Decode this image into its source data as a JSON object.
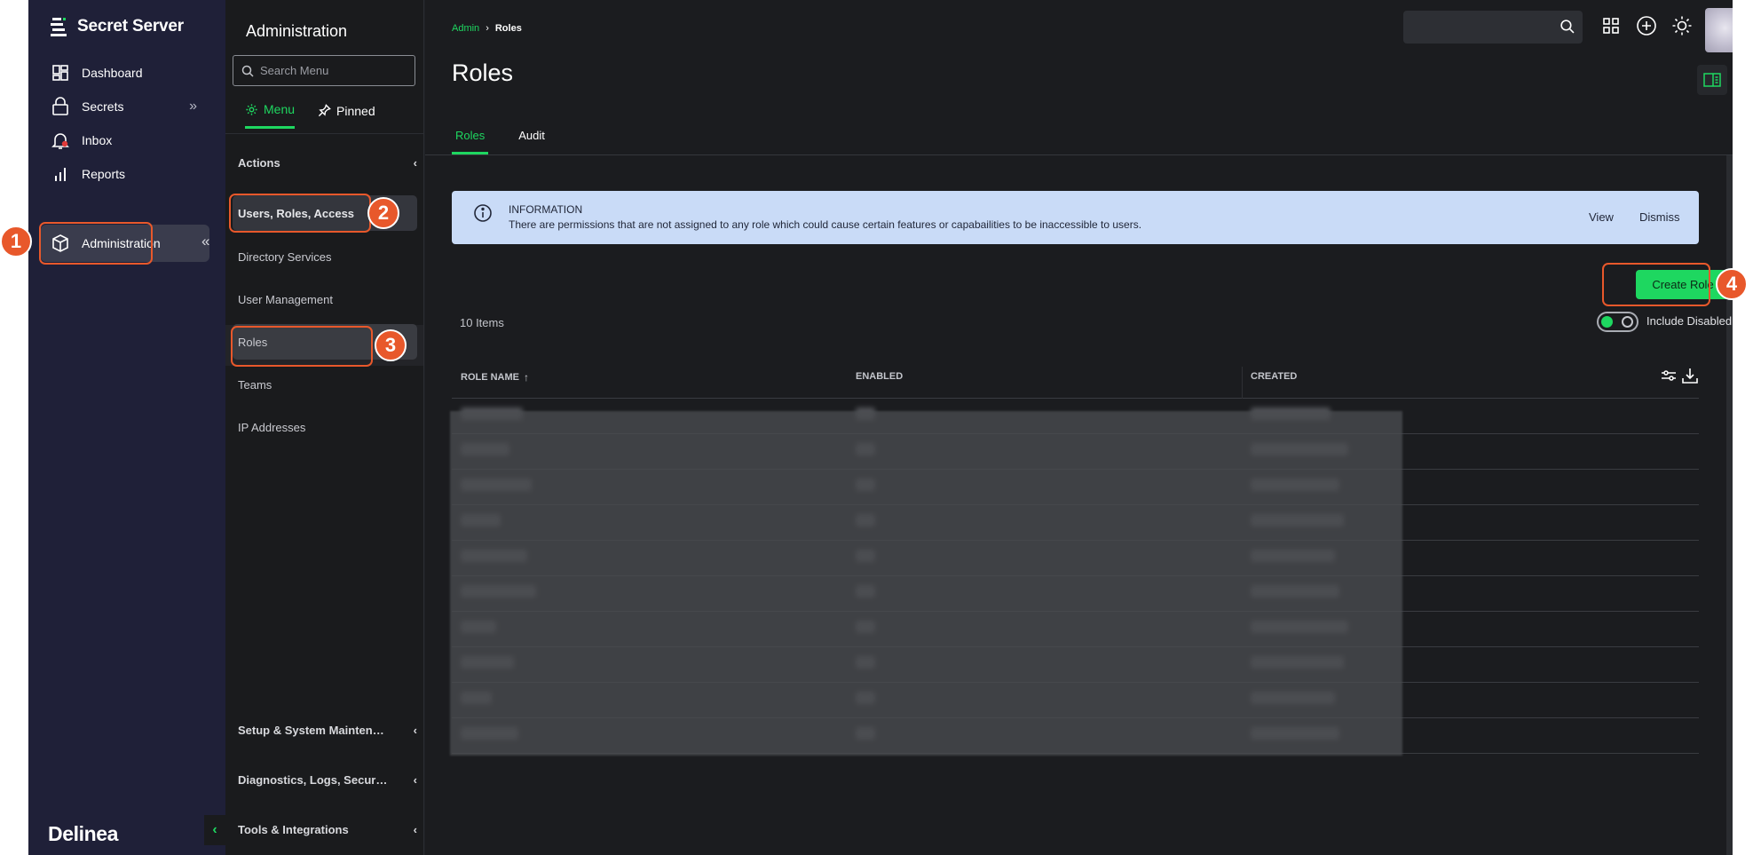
{
  "app": {
    "brand": "Secret Server",
    "footer_logo": "Delinea"
  },
  "nav": {
    "items": [
      {
        "label": "Dashboard",
        "icon": "dashboard-icon"
      },
      {
        "label": "Secrets",
        "icon": "lock-icon"
      },
      {
        "label": "Inbox",
        "icon": "bell-icon"
      },
      {
        "label": "Reports",
        "icon": "bar-chart-icon"
      },
      {
        "label": "Administration",
        "icon": "box-icon"
      }
    ]
  },
  "submenu": {
    "title": "Administration",
    "search_placeholder": "Search Menu",
    "tabs": [
      {
        "label": "Menu"
      },
      {
        "label": "Pinned"
      }
    ],
    "actions_label": "Actions",
    "items": [
      {
        "label": "Users, Roles, Access"
      },
      {
        "label": "Directory Services"
      },
      {
        "label": "User Management"
      },
      {
        "label": "Roles"
      },
      {
        "label": "Teams"
      },
      {
        "label": "IP Addresses"
      }
    ],
    "sections": [
      {
        "label": "Setup & System Maintenance"
      },
      {
        "label": "Diagnostics, Logs, Security"
      },
      {
        "label": "Tools & Integrations"
      }
    ]
  },
  "main": {
    "breadcrumb": {
      "root": "Admin",
      "current": "Roles"
    },
    "title": "Roles",
    "tabs": [
      {
        "label": "Roles"
      },
      {
        "label": "Audit"
      }
    ],
    "info": {
      "heading": "INFORMATION",
      "message": "There are permissions that are not assigned to any role which could cause certain features or capabailities to be inaccessible to users.",
      "view": "View",
      "dismiss": "Dismiss"
    },
    "create_button": "Create Role",
    "items_count": "10 Items",
    "include_disabled": "Include Disabled",
    "include_disabled_on": true,
    "columns": {
      "role_name": "ROLE NAME",
      "enabled": "ENABLED",
      "created": "CREATED"
    },
    "row_count": 10
  },
  "annotations": [
    "1",
    "2",
    "3",
    "4"
  ],
  "colors": {
    "accent": "#1ed760",
    "highlight": "#e8582b",
    "nav_bg": "#1f2038",
    "info_bg": "#c9dbf7"
  }
}
